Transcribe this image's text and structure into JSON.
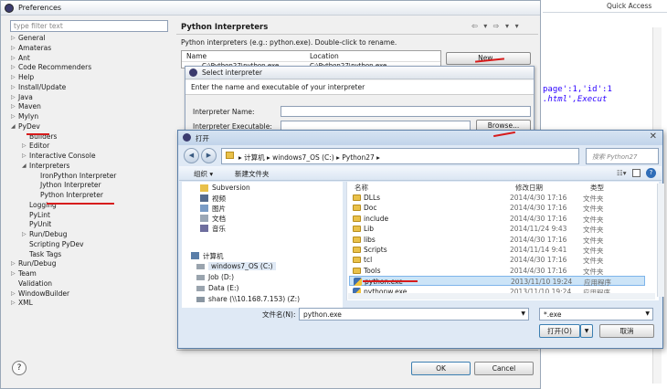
{
  "preferences": {
    "title": "Preferences",
    "filter_placeholder": "type filter text",
    "tree": [
      {
        "label": "General",
        "level": 0,
        "twisty": "▷"
      },
      {
        "label": "Amateras",
        "level": 0,
        "twisty": "▷"
      },
      {
        "label": "Ant",
        "level": 0,
        "twisty": "▷"
      },
      {
        "label": "Code Recommenders",
        "level": 0,
        "twisty": "▷"
      },
      {
        "label": "Help",
        "level": 0,
        "twisty": "▷"
      },
      {
        "label": "Install/Update",
        "level": 0,
        "twisty": "▷"
      },
      {
        "label": "Java",
        "level": 0,
        "twisty": "▷"
      },
      {
        "label": "Maven",
        "level": 0,
        "twisty": "▷"
      },
      {
        "label": "Mylyn",
        "level": 0,
        "twisty": "▷"
      },
      {
        "label": "PyDev",
        "level": 0,
        "twisty": "◢"
      },
      {
        "label": "Builders",
        "level": 1,
        "twisty": ""
      },
      {
        "label": "Editor",
        "level": 1,
        "twisty": "▷"
      },
      {
        "label": "Interactive Console",
        "level": 1,
        "twisty": "▷"
      },
      {
        "label": "Interpreters",
        "level": 1,
        "twisty": "◢"
      },
      {
        "label": "IronPython Interpreter",
        "level": 2,
        "twisty": ""
      },
      {
        "label": "Jython Interpreter",
        "level": 2,
        "twisty": ""
      },
      {
        "label": "Python Interpreter",
        "level": 2,
        "twisty": ""
      },
      {
        "label": "Logging",
        "level": 1,
        "twisty": ""
      },
      {
        "label": "PyLint",
        "level": 1,
        "twisty": ""
      },
      {
        "label": "PyUnit",
        "level": 1,
        "twisty": ""
      },
      {
        "label": "Run/Debug",
        "level": 1,
        "twisty": "▷"
      },
      {
        "label": "Scripting PyDev",
        "level": 1,
        "twisty": ""
      },
      {
        "label": "Task Tags",
        "level": 1,
        "twisty": ""
      },
      {
        "label": "Run/Debug",
        "level": 0,
        "twisty": "▷"
      },
      {
        "label": "Team",
        "level": 0,
        "twisty": "▷"
      },
      {
        "label": "Validation",
        "level": 0,
        "twisty": ""
      },
      {
        "label": "WindowBuilder",
        "level": 0,
        "twisty": "▷"
      },
      {
        "label": "XML",
        "level": 0,
        "twisty": "▷"
      }
    ],
    "page_title": "Python Interpreters",
    "nav_arrows": "⇦ ▾ ⇨ ▾ ▾",
    "description": "Python interpreters (e.g.: python.exe).   Double-click to rename.",
    "table_headers": {
      "name": "Name",
      "location": "Location"
    },
    "table_row": {
      "name": "C:\\Python27\\python.exe",
      "location": "C:\\Python27\\python.exe"
    },
    "new_button": "New...",
    "help_icon": "?",
    "ok_button": "OK",
    "cancel_button": "Cancel"
  },
  "select_interpreter": {
    "title": "Select interpreter",
    "message": "Enter the name and executable of your interpreter",
    "name_label": "Interpreter Name:",
    "exe_label": "Interpreter Executable:",
    "browse_button": "Browse..."
  },
  "open_dialog": {
    "title": "打开",
    "close": "✕",
    "breadcrumb": "▸ 计算机 ▸ windows7_OS (C:) ▸ Python27 ▸",
    "search_placeholder": "搜索 Python27",
    "organize": "组织 ▾",
    "new_folder": "新建文件夹",
    "left_tree": [
      {
        "label": "Subversion",
        "icon": "folder-icon"
      },
      {
        "label": "视频",
        "icon": "video-library-icon"
      },
      {
        "label": "图片",
        "icon": "picture-library-icon"
      },
      {
        "label": "文档",
        "icon": "document-library-icon"
      },
      {
        "label": "音乐",
        "icon": "music-library-icon"
      },
      {
        "label": "计算机",
        "icon": "computer-icon"
      },
      {
        "label": "windows7_OS (C:)",
        "icon": "drive-icon"
      },
      {
        "label": "Job (D:)",
        "icon": "drive-icon"
      },
      {
        "label": "Data (E:)",
        "icon": "drive-icon"
      },
      {
        "label": "share (\\\\10.168.7.153) (Z:)",
        "icon": "network-drive-icon"
      }
    ],
    "columns": {
      "name": "名称",
      "date": "修改日期",
      "type": "类型"
    },
    "files": [
      {
        "name": "DLLs",
        "date": "2014/4/30 17:16",
        "type": "文件夹",
        "kind": "folder"
      },
      {
        "name": "Doc",
        "date": "2014/4/30 17:16",
        "type": "文件夹",
        "kind": "folder"
      },
      {
        "name": "include",
        "date": "2014/4/30 17:16",
        "type": "文件夹",
        "kind": "folder"
      },
      {
        "name": "Lib",
        "date": "2014/11/24 9:43",
        "type": "文件夹",
        "kind": "folder"
      },
      {
        "name": "libs",
        "date": "2014/4/30 17:16",
        "type": "文件夹",
        "kind": "folder"
      },
      {
        "name": "Scripts",
        "date": "2014/11/14 9:41",
        "type": "文件夹",
        "kind": "folder"
      },
      {
        "name": "tcl",
        "date": "2014/4/30 17:16",
        "type": "文件夹",
        "kind": "folder"
      },
      {
        "name": "Tools",
        "date": "2014/4/30 17:16",
        "type": "文件夹",
        "kind": "folder"
      },
      {
        "name": "python.exe",
        "date": "2013/11/10 19:24",
        "type": "应用程序",
        "kind": "exe"
      },
      {
        "name": "pythonw.exe",
        "date": "2013/11/10 19:24",
        "type": "应用程序",
        "kind": "exe"
      }
    ],
    "filename_label": "文件名(N):",
    "filename_value": "python.exe",
    "filter_value": "*.exe",
    "open_button": "打开(O)",
    "cancel_button": "取消"
  },
  "ide": {
    "quick_access": "Quick Access",
    "code_line1": "page':1,'id':1",
    "code_line2": ".html',Execut"
  },
  "colors": {
    "annotation_red": "#d71c1c",
    "selection_blue": "#cce4f7"
  }
}
